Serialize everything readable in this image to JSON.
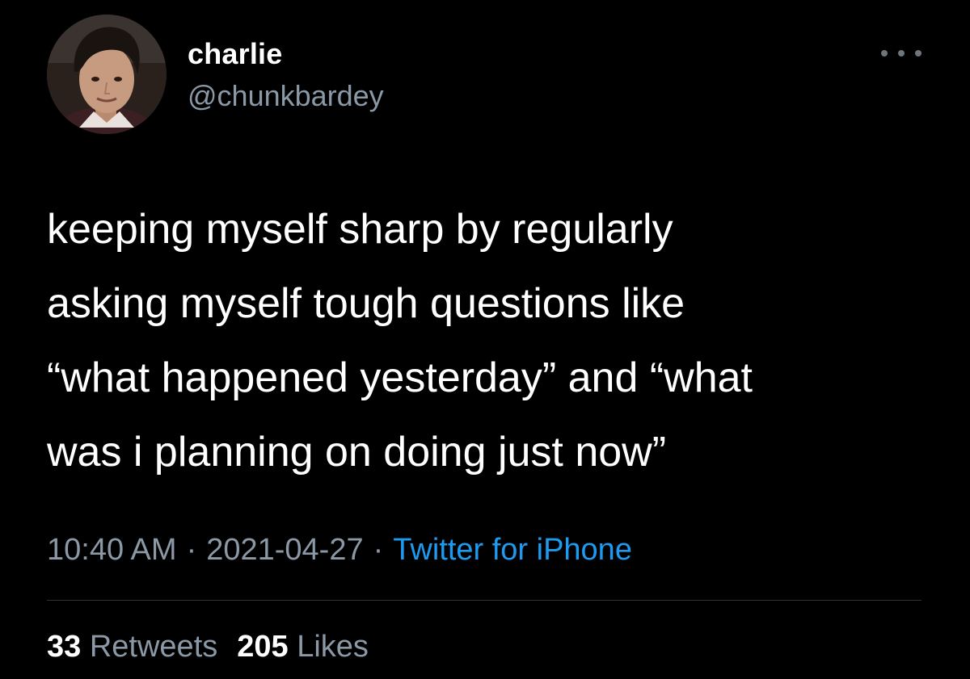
{
  "user": {
    "display_name": "charlie",
    "handle": "@chunkbardey"
  },
  "more_icon": "more-horizontal-icon",
  "tweet": {
    "lines": [
      "keeping myself sharp by regularly",
      "asking myself tough questions like",
      "“what happened yesterday” and “what",
      "was i planning on doing just now”"
    ]
  },
  "meta": {
    "time": "10:40 AM",
    "separator": "·",
    "date": "2021-04-27",
    "source": "Twitter for iPhone"
  },
  "stats": {
    "retweets_count": "33",
    "retweets_label": "Retweets",
    "likes_count": "205",
    "likes_label": "Likes"
  },
  "colors": {
    "background": "#000000",
    "primary_text": "#ffffff",
    "secondary_text": "#8b98a5",
    "link": "#1d9bf0",
    "divider": "#2f3336"
  }
}
